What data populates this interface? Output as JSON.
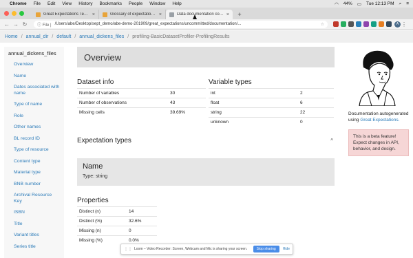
{
  "menubar": {
    "items": [
      "Chrome",
      "File",
      "Edit",
      "View",
      "History",
      "Bookmarks",
      "People",
      "Window",
      "Help"
    ],
    "battery": "44%",
    "clock": "Tue 12:13 PM"
  },
  "tabs": [
    {
      "title": "Great Expectations Test Drive",
      "favicon_color": "#e8a43a"
    },
    {
      "title": "Glossary of expectations — gre",
      "favicon_color": "#e8a43a"
    },
    {
      "title": "Data documentation compiled b",
      "favicon_color": "#9aa0a6",
      "active": true
    }
  ],
  "addressbar": {
    "info_label": "File",
    "url": "/Users/abe/Desktop/sept_demo/abe-demo-201909/great_expectations/uncommitted/documentation/..."
  },
  "breadcrumb": {
    "items": [
      "Home",
      "annual_dir",
      "default",
      "annual_dickens_files",
      "profiling-BasicDatasetProfiler-ProfilingResults"
    ],
    "separator": "/"
  },
  "sidebar": {
    "title": "annual_dickens_files",
    "items": [
      "Overview",
      "Name",
      "Dates associated with name",
      "Type of name",
      "Role",
      "Other names",
      "BL record ID",
      "Type of resource",
      "Content type",
      "Material type",
      "BNB number",
      "Archival Resource Key",
      "ISBN",
      "Title",
      "Variant titles",
      "Series title"
    ]
  },
  "overview": {
    "title": "Overview",
    "dataset_info": {
      "title": "Dataset info",
      "rows": [
        {
          "label": "Number of variables",
          "value": "30"
        },
        {
          "label": "Number of observations",
          "value": "43"
        },
        {
          "label": "Missing cells",
          "value": "39.69%"
        }
      ]
    },
    "variable_types": {
      "title": "Variable types",
      "rows": [
        {
          "label": "int",
          "value": "2"
        },
        {
          "label": "float",
          "value": "6"
        },
        {
          "label": "string",
          "value": "22"
        },
        {
          "label": "unknown",
          "value": "0"
        }
      ]
    }
  },
  "expectation_types": {
    "title": "Expectation types",
    "toggle": "^"
  },
  "column": {
    "name": "Name",
    "type_text": "Type: string"
  },
  "properties": {
    "title": "Properties",
    "rows": [
      {
        "label": "Distinct (n)",
        "value": "14"
      },
      {
        "label": "Distinct (%)",
        "value": "32.6%"
      },
      {
        "label": "Missing (n)",
        "value": "0"
      },
      {
        "label": "Missing (%)",
        "value": "0.0%"
      }
    ]
  },
  "rightpanel": {
    "doc_text": "Documentation autogenerated using",
    "doc_link": "Great Expectations.",
    "beta_text": "This is a beta feature! Expect changes in API, behavior, and design."
  },
  "loom": {
    "message": "Loom – Video Recorder: Screen, Webcam and Mic is sharing your screen.",
    "stop_label": "Stop sharing",
    "hide_label": "Hide"
  },
  "colors": {
    "link": "#2a7ab8",
    "beta_bg": "#f6d6d6",
    "header_bg": "#e0e0e0"
  }
}
